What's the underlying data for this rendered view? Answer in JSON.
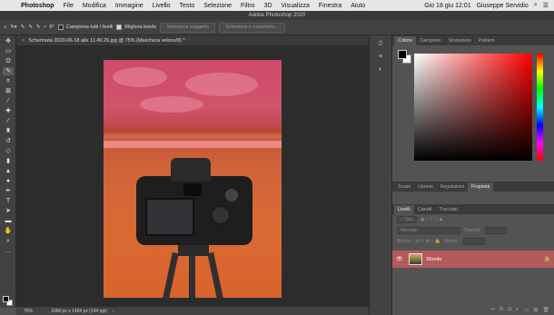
{
  "menubar": {
    "apple": "",
    "items": [
      "Photoshop",
      "File",
      "Modifica",
      "Immagine",
      "Livello",
      "Testo",
      "Selezione",
      "Filtro",
      "3D",
      "Visualizza",
      "Finestra",
      "Aiuto"
    ],
    "clock": "Gio 18 giu 12:01",
    "user": "Giuseppe Servidio"
  },
  "window": {
    "title": "Adobe Photoshop 2020"
  },
  "options": {
    "size": "0°",
    "sample_all": "Campiona tutti i livelli",
    "enhance_edge": "Migliora bordo",
    "select_subject": "Seleziona soggetto",
    "select_mask": "Seleziona e maschera..."
  },
  "document": {
    "tab": "Schermata 2020-06-18 alle 11.49.29.jpg @ 75% (Maschera veloce/8) *",
    "zoom": "75%",
    "info": "1068 px x 1484 px (144 ppi)"
  },
  "color_panel": {
    "tabs": [
      "Colore",
      "Campioni",
      "Sfumature",
      "Pattern"
    ],
    "active": 0
  },
  "mid_panel": {
    "tabs": [
      "Scopri",
      "Librerie",
      "Regolazioni",
      "Proprietà"
    ],
    "active": 3
  },
  "layers_panel": {
    "tabs": [
      "Livelli",
      "Canali",
      "Tracciati"
    ],
    "active": 0,
    "kind": "Tipo",
    "blend": "Normale",
    "opacity_label": "Opacità:",
    "lock_label": "Blocca:",
    "fill_label": "Riemp.:",
    "layer_name": "Sfondo"
  },
  "colors": {
    "quick_mask": "#d8632d",
    "layer_selected": "#b35a5c"
  }
}
